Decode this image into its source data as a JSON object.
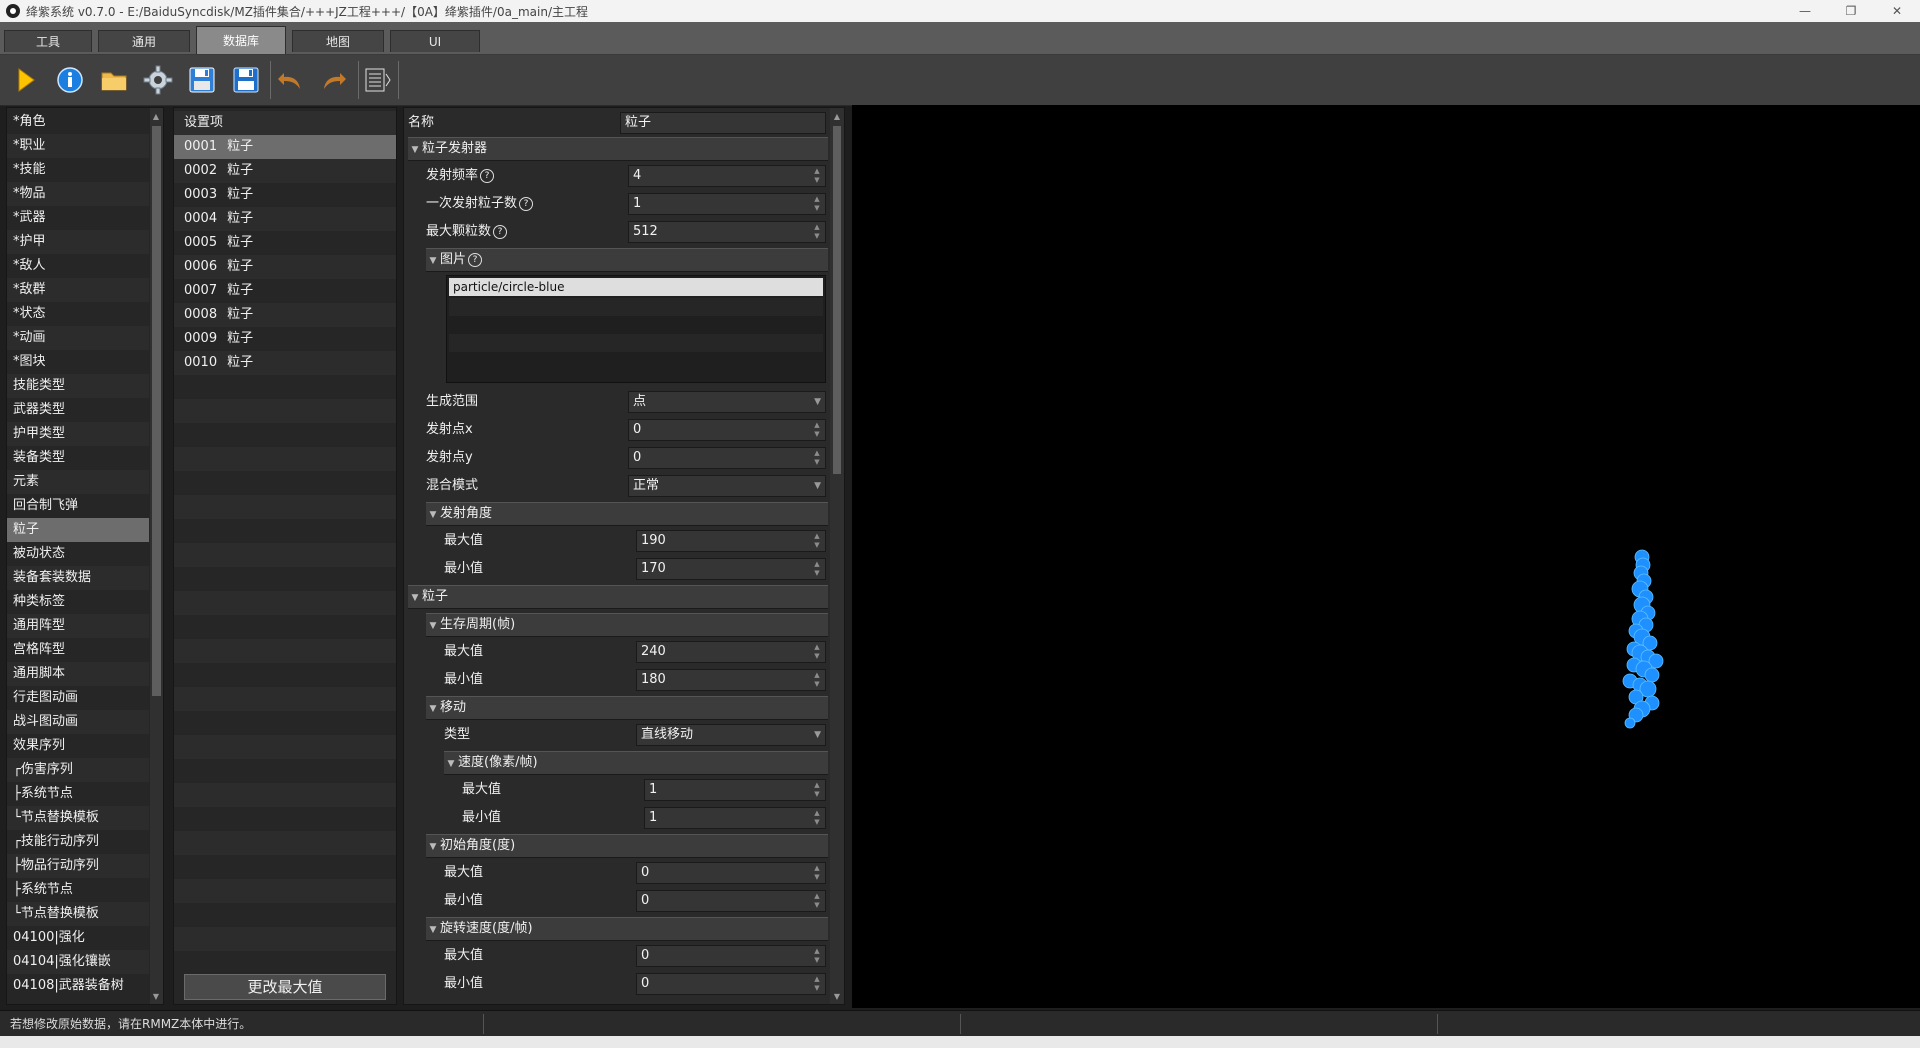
{
  "window": {
    "title": "绛紫系统 v0.7.0 - E:/BaiduSyncdisk/MZ插件集合/+++JZ工程+++/【0A】绛紫插件/0a_main/主工程",
    "controls": [
      "—",
      "❐",
      "✕"
    ]
  },
  "tabs": [
    {
      "label": "工具"
    },
    {
      "label": "通用"
    },
    {
      "label": "数据库"
    },
    {
      "label": "地图"
    },
    {
      "label": "UI"
    }
  ],
  "toolbar": {
    "icons": [
      "play-icon",
      "info-icon",
      "folder-icon",
      "gear-icon",
      "save-as-icon",
      "save-icon",
      "undo-icon",
      "redo-icon",
      "list-icon"
    ]
  },
  "categories": [
    "*角色",
    "*职业",
    "*技能",
    "*物品",
    "*武器",
    "*护甲",
    "*敌人",
    "*敌群",
    "*状态",
    "*动画",
    "*图块",
    "技能类型",
    "武器类型",
    "护甲类型",
    "装备类型",
    "元素",
    "回合制飞弹",
    "粒子",
    "被动状态",
    "装备套装数据",
    "种类标签",
    "通用阵型",
    "宫格阵型",
    "通用脚本",
    "行走图动画",
    "战斗图动画",
    "效果序列",
    "┌伤害序列",
    "├系统节点",
    "└节点替换模板",
    "┌技能行动序列",
    "├物品行动序列",
    "├系统节点",
    "└节点替换模板",
    "04100|强化",
    "04104|强化镶嵌",
    "04108|武器装备树"
  ],
  "settings": {
    "header": "设置项",
    "items": [
      {
        "id": "0001",
        "name": "粒子"
      },
      {
        "id": "0002",
        "name": "粒子"
      },
      {
        "id": "0003",
        "name": "粒子"
      },
      {
        "id": "0004",
        "name": "粒子"
      },
      {
        "id": "0005",
        "name": "粒子"
      },
      {
        "id": "0006",
        "name": "粒子"
      },
      {
        "id": "0007",
        "name": "粒子"
      },
      {
        "id": "0008",
        "name": "粒子"
      },
      {
        "id": "0009",
        "name": "粒子"
      },
      {
        "id": "0010",
        "name": "粒子"
      }
    ],
    "change_max_label": "更改最大值"
  },
  "props": {
    "name_label": "名称",
    "name_value": "粒子",
    "emitter_section": "粒子发射器",
    "freq_label": "发射频率",
    "freq_value": "4",
    "per_emit_label": "一次发射粒子数",
    "per_emit_value": "1",
    "max_count_label": "最大颗粒数",
    "max_count_value": "512",
    "image_section": "图片",
    "image_item": "particle/circle-blue",
    "range_label": "生成范围",
    "range_value": "点",
    "emit_x_label": "发射点x",
    "emit_x_value": "0",
    "emit_y_label": "发射点y",
    "emit_y_value": "0",
    "blend_label": "混合模式",
    "blend_value": "正常",
    "angle_section": "发射角度",
    "angle_max_label": "最大值",
    "angle_max_value": "190",
    "angle_min_label": "最小值",
    "angle_min_value": "170",
    "particle_section": "粒子",
    "life_section": "生存周期(帧)",
    "life_max_label": "最大值",
    "life_max_value": "240",
    "life_min_label": "最小值",
    "life_min_value": "180",
    "move_section": "移动",
    "move_type_label": "类型",
    "move_type_value": "直线移动",
    "speed_section": "速度(像素/帧)",
    "speed_max_label": "最大值",
    "speed_max_value": "1",
    "speed_min_label": "最小值",
    "speed_min_value": "1",
    "init_angle_section": "初始角度(度)",
    "init_max_label": "最大值",
    "init_max_value": "0",
    "init_min_label": "最小值",
    "init_min_value": "0",
    "rot_section": "旋转速度(度/帧)",
    "rot_max_label": "最大值",
    "rot_max_value": "0",
    "rot_min_label": "最小值",
    "rot_min_value": "0",
    "help_glyph": "?"
  },
  "preview": {
    "particle_color": "#1e90ff",
    "background": "#000000"
  },
  "status": {
    "message": "若想修改原始数据，请在RMMZ本体中进行。"
  }
}
